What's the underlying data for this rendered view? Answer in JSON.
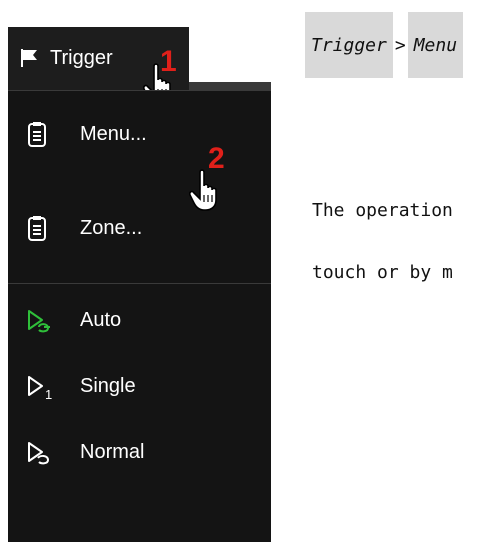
{
  "trigger_tab": {
    "label": "Trigger",
    "step_marker": "1"
  },
  "menu": {
    "step_marker": "2",
    "items": [
      {
        "label": "Menu...",
        "icon": "document-icon"
      },
      {
        "label": "Zone...",
        "icon": "document-icon"
      }
    ],
    "modes": [
      {
        "label": "Auto",
        "icon": "auto-trigger-icon",
        "active": true
      },
      {
        "label": "Single",
        "icon": "single-trigger-icon",
        "active": false
      },
      {
        "label": "Normal",
        "icon": "normal-trigger-icon",
        "active": false
      }
    ]
  },
  "annotation": {
    "path_start": "Trigger",
    "path_separator": ">",
    "path_end": "Menu",
    "line1": "The operation",
    "line2": "touch or by m"
  },
  "colors": {
    "panel_bg": "#141414",
    "step_marker": "#e0201a",
    "active_icon": "#2fbf3a",
    "path_highlight": "#d9d9d9"
  }
}
